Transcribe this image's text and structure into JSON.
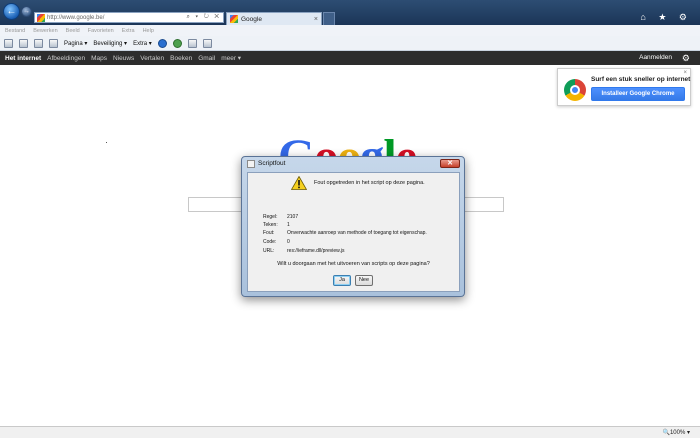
{
  "browser": {
    "address": {
      "url": "http://www.google.be/",
      "controls": "⌕ ▾ ↻ ✕"
    },
    "tab": {
      "label": "Google",
      "close": "×"
    },
    "window_icons": "⌂ ★ ⚙",
    "menu": [
      "Bestand",
      "Bewerken",
      "Beeld",
      "Favorieten",
      "Extra",
      "Help"
    ],
    "command_bar": {
      "page": "Pagina ▾",
      "security": "Beveiliging ▾",
      "extra": "Extra ▾"
    },
    "status": {
      "zoom": "🔍100% ▾"
    }
  },
  "google_bar": {
    "links": [
      "Het internet",
      "Afbeeldingen",
      "Maps",
      "Nieuws",
      "Vertalen",
      "Boeken",
      "Gmail",
      "meer ▾"
    ],
    "signin": "Aanmelden",
    "gear": "⚙"
  },
  "promo": {
    "title": "Surf een stuk sneller op internet",
    "button": "Installeer Google Chrome",
    "close": "×"
  },
  "google_logo": [
    "G",
    "o",
    "o",
    "g",
    "l",
    "e"
  ],
  "dialog": {
    "title": "Scriptfout",
    "close": "✕",
    "message": "Fout opgetreden in het script op deze pagina.",
    "fields": [
      {
        "key": "Regel:",
        "value": "2107"
      },
      {
        "key": "Teken:",
        "value": "1"
      },
      {
        "key": "Fout:",
        "value": "Onverwachte aanroep van methode of toegang tot eigenschap."
      },
      {
        "key": "Code:",
        "value": "0"
      },
      {
        "key": "URL:",
        "value": "res://ieframe.dll/preview.js"
      }
    ],
    "question": "Wilt u doorgaan met het uitvoeren van scripts op deze pagina?",
    "yes": "Ja",
    "no": "Nee"
  },
  "colors": {
    "title_bar": "#2d4d73",
    "google_bar": "#2d2d2d",
    "chrome_button": "#4d90fe"
  }
}
